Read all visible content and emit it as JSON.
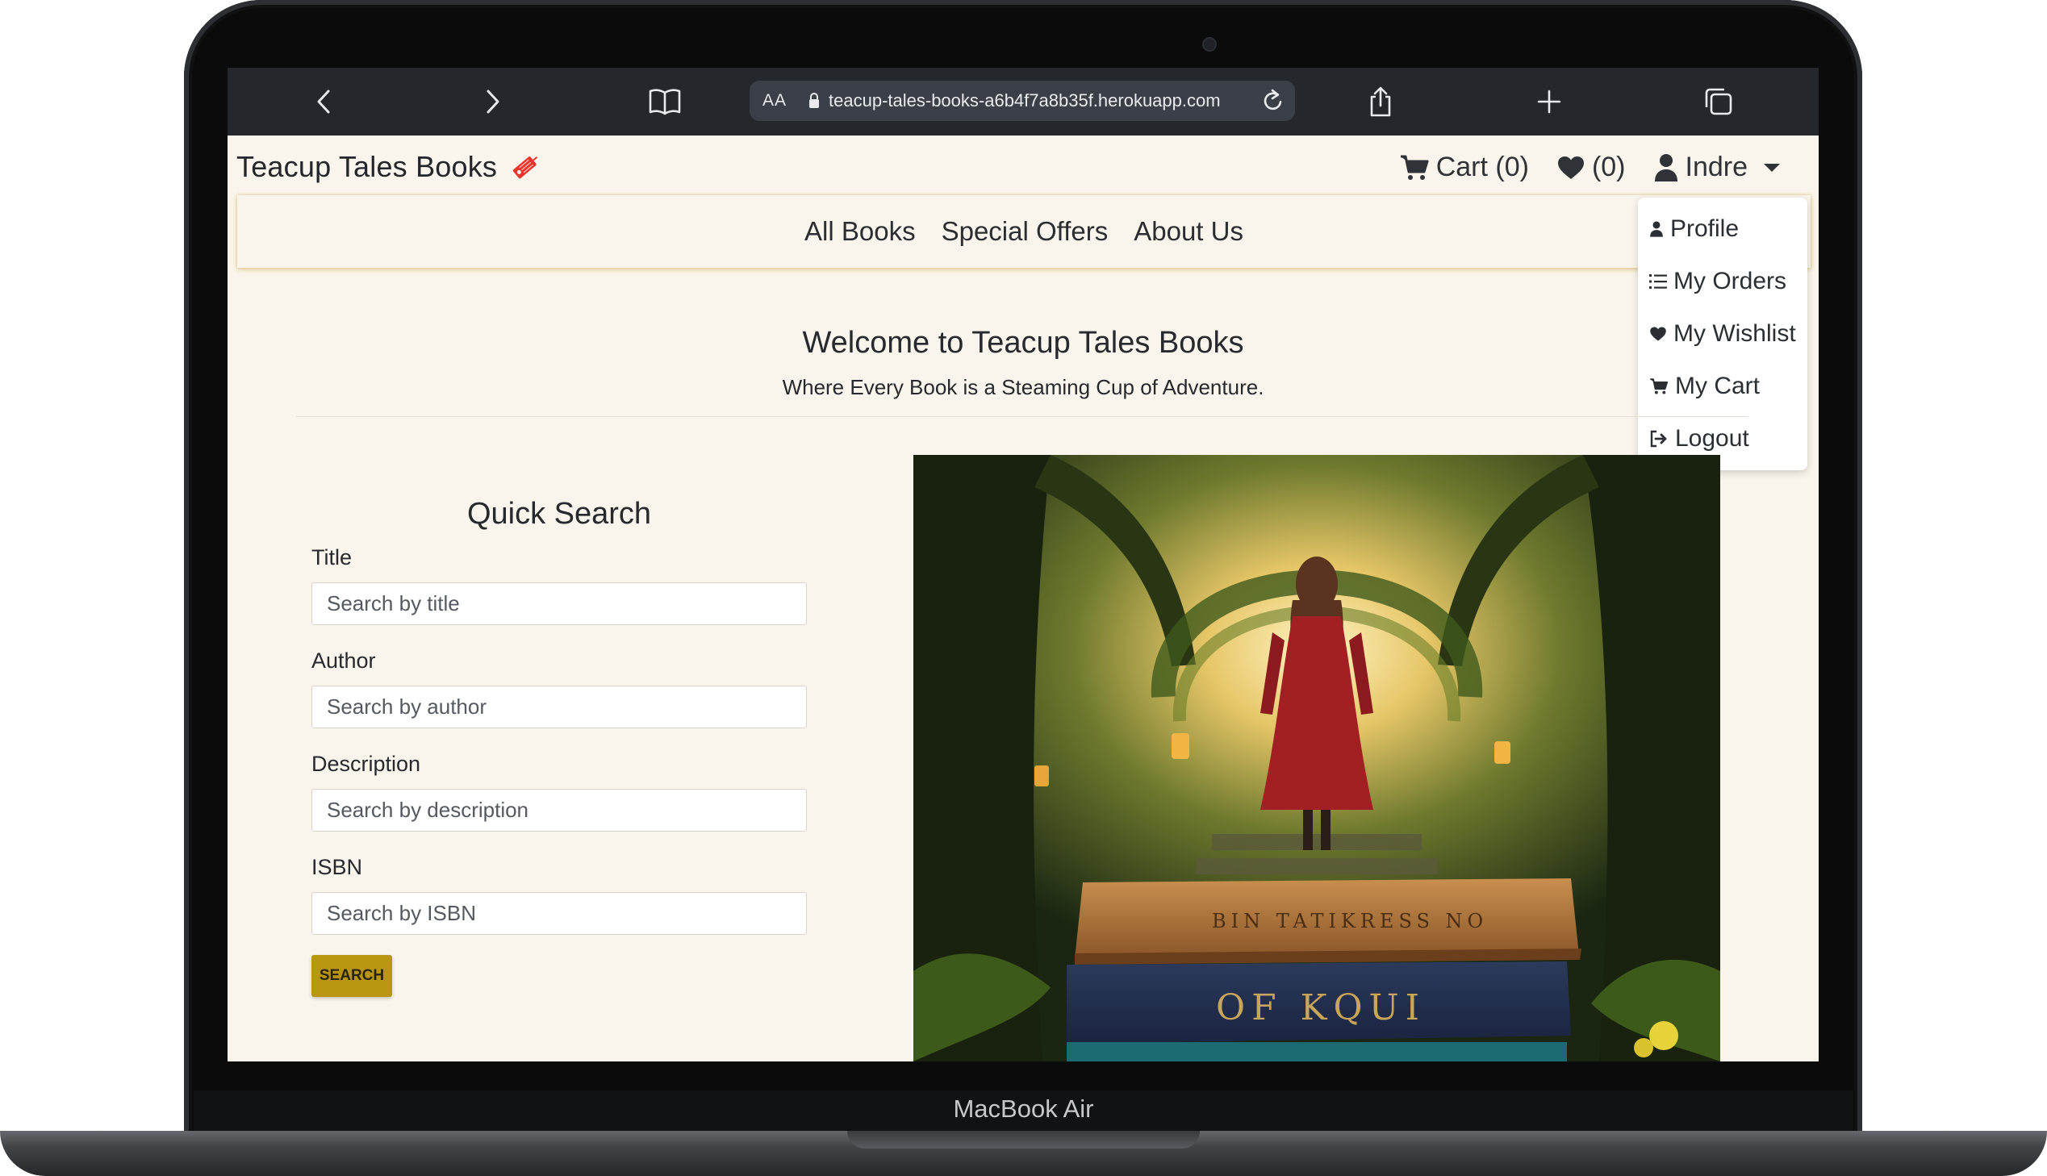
{
  "device": {
    "model_label": "MacBook Air"
  },
  "browser": {
    "text_size_label": "AA",
    "url": "teacup-tales-books-a6b4f7a8b35f.herokuapp.com"
  },
  "site": {
    "brand": "Teacup Tales Books",
    "cart_label": "Cart (0)",
    "wishlist_count": "(0)",
    "user_name": "Indre",
    "accent_color": "#b8960f"
  },
  "nav": {
    "items": [
      "All Books",
      "Special Offers",
      "About Us"
    ]
  },
  "user_menu": {
    "items": [
      {
        "label": "Profile",
        "icon": "user-icon"
      },
      {
        "label": "My Orders",
        "icon": "list-icon"
      },
      {
        "label": "My Wishlist",
        "icon": "heart-icon"
      },
      {
        "label": "My Cart",
        "icon": "cart-icon"
      },
      {
        "label": "Logout",
        "icon": "logout-icon"
      }
    ]
  },
  "hero": {
    "title": "Welcome to Teacup Tales Books",
    "tagline": "Where Every Book is a Steaming Cup of Adventure.",
    "image_book_text": [
      "BIN TATIKRESS NO",
      "OF KQUI"
    ]
  },
  "quick_search": {
    "title": "Quick Search",
    "fields": [
      {
        "label": "Title",
        "placeholder": "Search by title"
      },
      {
        "label": "Author",
        "placeholder": "Search by author"
      },
      {
        "label": "Description",
        "placeholder": "Search by description"
      },
      {
        "label": "ISBN",
        "placeholder": "Search by ISBN"
      }
    ],
    "button_label": "SEARCH"
  }
}
